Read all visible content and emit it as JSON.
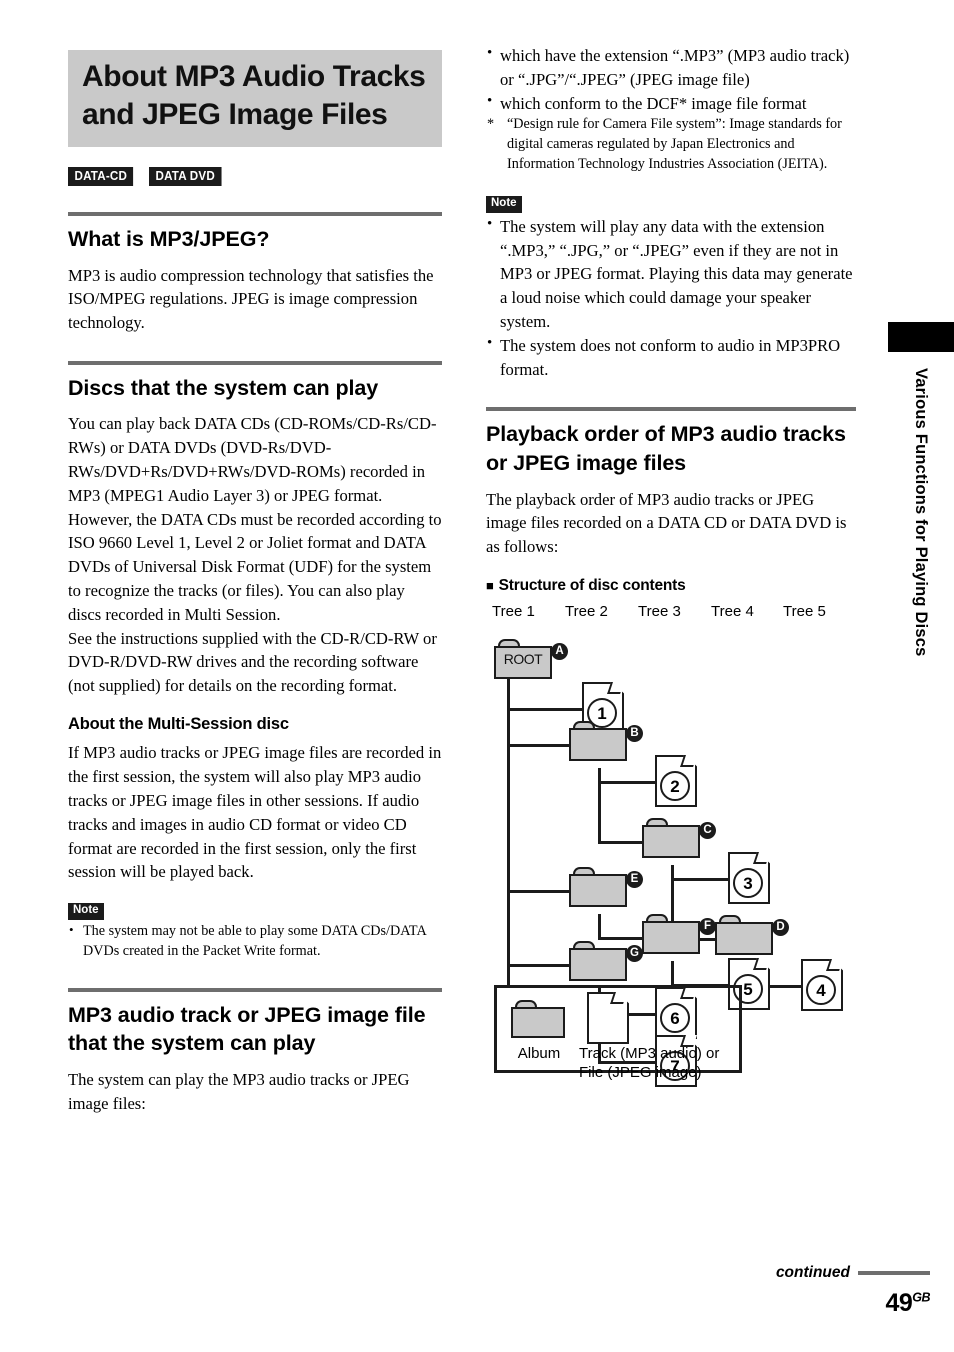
{
  "document": {
    "title": "About MP3 Audio Tracks and JPEG Image Files",
    "page_number": "49",
    "page_suffix": "GB",
    "continued_label": "continued",
    "side_tab_label": "Various Functions for Playing Discs"
  },
  "badges": [
    {
      "label": "DATA-CD"
    },
    {
      "label": "DATA DVD"
    }
  ],
  "left_column": {
    "section_1": {
      "heading": "What is MP3/JPEG?",
      "paragraph": "MP3 is audio compression technology that satisfies the ISO/MPEG regulations. JPEG is image compression technology."
    },
    "section_2": {
      "heading": "Discs that the system can play",
      "paragraph_1": "You can play back DATA CDs (CD-ROMs/CD-Rs/CD-RWs) or DATA DVDs (DVD-Rs/DVD-RWs/DVD+Rs/DVD+RWs/DVD-ROMs) recorded in MP3 (MPEG1 Audio Layer 3) or JPEG format. However, the DATA CDs must be recorded according to ISO 9660 Level 1, Level 2 or Joliet format and DATA DVDs of Universal Disk Format (UDF) for the system to recognize the tracks (or files). You can also play discs recorded in Multi Session.",
      "paragraph_2": "See the instructions supplied with the CD-R/CD-RW or DVD-R/DVD-RW drives and the recording software (not supplied) for details on the recording format.",
      "subheading": "About the Multi-Session disc",
      "paragraph_3": "If MP3 audio tracks or JPEG image files are recorded in the first session, the system will also play MP3 audio tracks or JPEG image files in other sessions. If audio tracks and images in audio CD format or video CD format are recorded in the first session, only the first session will be played back.",
      "note_label": "Note",
      "note_items": [
        "The system may not be able to play some DATA CDs/DATA DVDs created in the Packet Write format."
      ]
    },
    "section_3": {
      "heading": "MP3 audio track or JPEG image file that the system can play",
      "paragraph": "The system can play the MP3 audio tracks or JPEG image files:"
    }
  },
  "right_column": {
    "spec_bullets": [
      "which have the extension “.MP3” (MP3 audio track) or “.JPG”/“.JPEG” (JPEG image file)",
      "which conform to the DCF* image file format"
    ],
    "footnote_marker": "*",
    "footnote_text": "“Design rule for Camera File system”: Image standards for digital cameras regulated by Japan Electronics and Information Technology Industries Association (JEITA).",
    "note_label": "Note",
    "note_items": [
      "The system will play any data with the extension “.MP3,” “.JPG,” or “.JPEG” even if they are not in MP3 or JPEG format. Playing this data may generate a loud noise which could damage your speaker system.",
      "The system does not conform to audio in MP3PRO format."
    ],
    "section_playback": {
      "heading": "Playback order of MP3 audio tracks or JPEG image files",
      "paragraph": "The playback order of MP3 audio tracks or JPEG image files recorded on a DATA CD or DATA DVD is as follows:",
      "structure_heading": "Structure of disc contents",
      "structure_square": "■"
    }
  },
  "tree_diagram": {
    "column_labels": [
      "Tree 1",
      "Tree 2",
      "Tree 3",
      "Tree 4",
      "Tree 5"
    ],
    "root_label": "ROOT",
    "folders": [
      {
        "tag": "A",
        "label": "ROOT"
      },
      {
        "tag": "B",
        "label": ""
      },
      {
        "tag": "C",
        "label": ""
      },
      {
        "tag": "D",
        "label": ""
      },
      {
        "tag": "E",
        "label": ""
      },
      {
        "tag": "F",
        "label": ""
      },
      {
        "tag": "G",
        "label": ""
      }
    ],
    "files": [
      {
        "number": "1"
      },
      {
        "number": "2"
      },
      {
        "number": "3"
      },
      {
        "number": "4"
      },
      {
        "number": "5"
      },
      {
        "number": "6"
      },
      {
        "number": "7"
      }
    ],
    "legend": {
      "folder_caption": "Album",
      "file_caption": "Track (MP3 audio) or File (JPEG image)"
    }
  },
  "colors": {
    "banner_gray": "#c9c9c9",
    "rule_gray": "#6e6e6e",
    "ink": "#1b1b1b",
    "folder_fill": "#c9c9c9"
  }
}
